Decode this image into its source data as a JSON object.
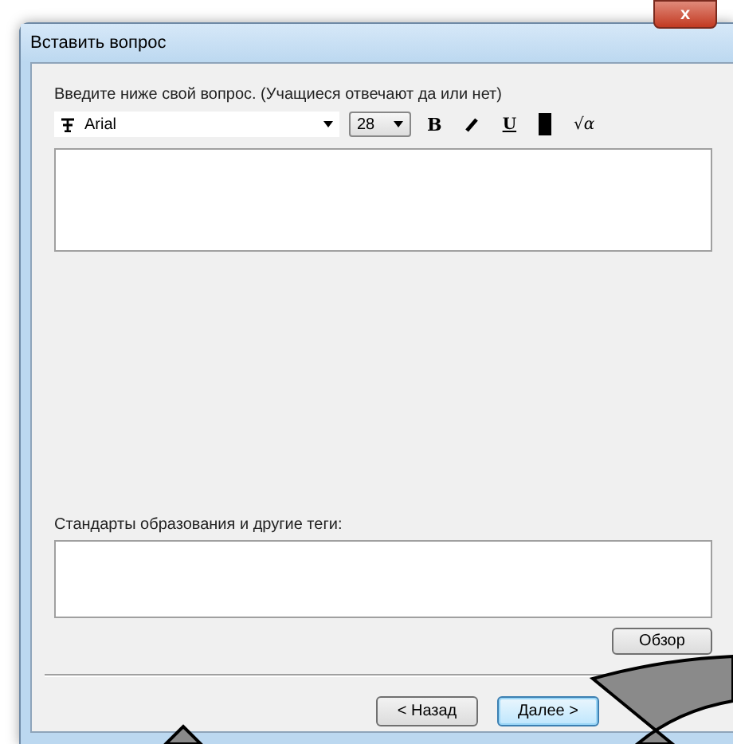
{
  "window": {
    "title": "Вставить вопрос",
    "close": "x"
  },
  "question": {
    "label": "Введите ниже свой вопрос. (Учащиеся отвечают да или нет)",
    "font": "Arial",
    "size": "28"
  },
  "format_buttons": [
    {
      "kind": "bold",
      "label": "B"
    },
    {
      "kind": "italic"
    },
    {
      "kind": "underline",
      "label": "U"
    },
    {
      "kind": "color"
    },
    {
      "kind": "equation",
      "label": "√α"
    }
  ],
  "tags": {
    "label": "Стандарты образования и другие теги:"
  },
  "browse_button": "Обзор",
  "buttons": [
    {
      "label": "< Назад",
      "selected": false
    },
    {
      "label": "Далее >",
      "selected": true
    }
  ]
}
